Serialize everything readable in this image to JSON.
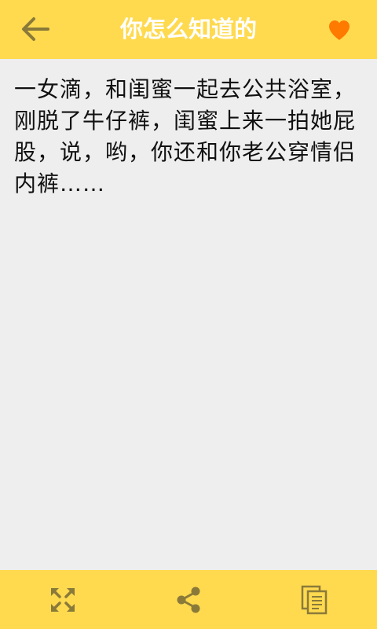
{
  "header": {
    "title": "你怎么知道的",
    "back_icon": "arrow-left-icon",
    "favorite_icon": "heart-icon",
    "favorite_color": "#ff7a00",
    "bar_color": "#ffda4f"
  },
  "content": {
    "text": "一女滴，和闺蜜一起去公共浴室，刚脱了牛仔裤，闺蜜上来一拍她屁股，说，哟，你还和你老公穿情侣内裤……"
  },
  "bottom_bar": {
    "actions": [
      {
        "icon": "expand-icon"
      },
      {
        "icon": "share-icon"
      },
      {
        "icon": "copy-icon"
      }
    ],
    "icon_color": "#8a7a3a"
  }
}
